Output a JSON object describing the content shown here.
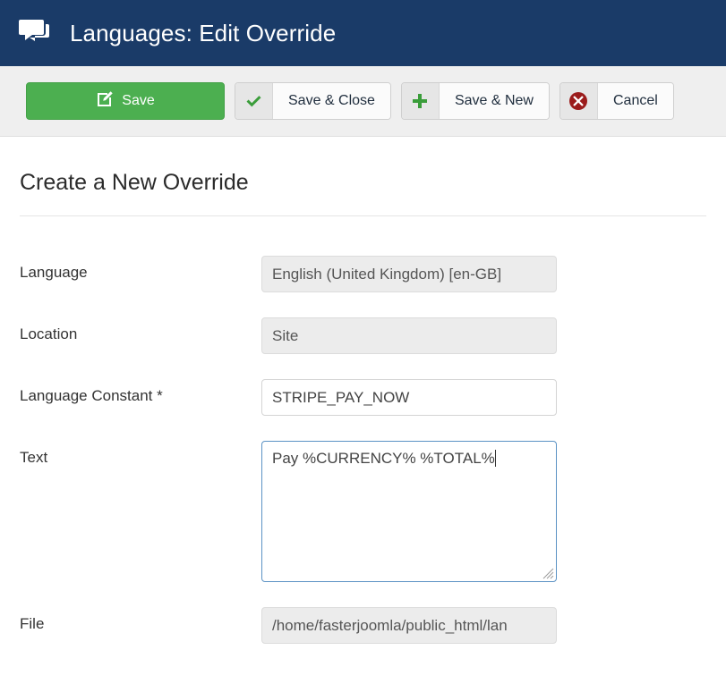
{
  "header": {
    "icon": "comments-icon",
    "title": "Languages: Edit Override",
    "bg_color": "#1a3b68"
  },
  "toolbar": {
    "buttons": [
      {
        "name": "save-button",
        "label": "Save",
        "icon": "pencil-square-icon",
        "style": "primary",
        "accent": "#4caf50"
      },
      {
        "name": "save-close-button",
        "label": "Save & Close",
        "icon": "check-icon",
        "style": "split",
        "accent": "#3a9d3a"
      },
      {
        "name": "save-new-button",
        "label": "Save & New",
        "icon": "plus-icon",
        "style": "split",
        "accent": "#3a9d3a"
      },
      {
        "name": "cancel-button",
        "label": "Cancel",
        "icon": "times-circle-icon",
        "style": "split",
        "accent": "#9b1c1c"
      }
    ]
  },
  "page": {
    "title": "Create a New Override"
  },
  "form": {
    "fields": [
      {
        "name": "language",
        "label": "Language",
        "value": "English (United Kingdom) [en-GB]",
        "placeholder": "",
        "type": "text",
        "state": "disabled"
      },
      {
        "name": "location",
        "label": "Location",
        "value": "Site",
        "placeholder": "",
        "type": "text",
        "state": "disabled"
      },
      {
        "name": "language-constant",
        "label": "Language Constant *",
        "value": "STRIPE_PAY_NOW",
        "placeholder": "",
        "type": "text",
        "state": "editable"
      },
      {
        "name": "text",
        "label": "Text",
        "value": "Pay %CURRENCY% %TOTAL%",
        "placeholder": "",
        "type": "textarea",
        "state": "focused"
      },
      {
        "name": "file",
        "label": "File",
        "value": "/home/fasterjoomla/public_html/lan",
        "placeholder": "",
        "type": "text",
        "state": "disabled"
      }
    ]
  }
}
